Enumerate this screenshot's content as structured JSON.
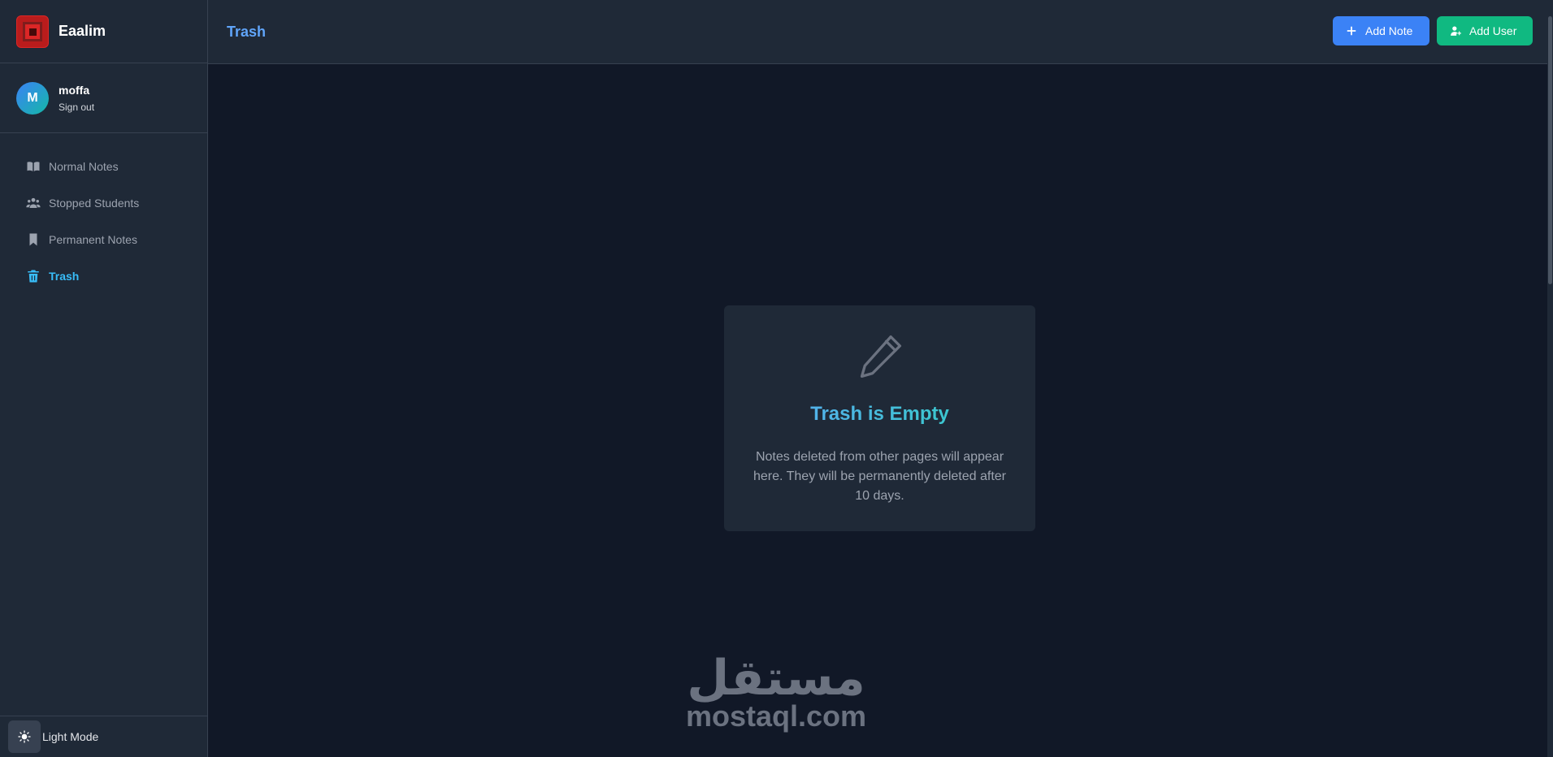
{
  "brand": {
    "name": "Eaalim"
  },
  "user": {
    "initial": "M",
    "name": "moffa",
    "sign_out": "Sign out"
  },
  "sidebar": {
    "items": [
      {
        "label": "Normal Notes",
        "icon": "book-open-icon",
        "active": false
      },
      {
        "label": "Stopped Students",
        "icon": "users-icon",
        "active": false
      },
      {
        "label": "Permanent Notes",
        "icon": "bookmark-icon",
        "active": false
      },
      {
        "label": "Trash",
        "icon": "trash-icon",
        "active": true
      }
    ],
    "theme_label": "Light Mode"
  },
  "header": {
    "title": "Trash",
    "add_note_label": "Add Note",
    "add_user_label": "Add User"
  },
  "empty_state": {
    "icon": "pencil-icon",
    "title": "Trash is Empty",
    "description": "Notes deleted from other pages will appear here. They will be permanently deleted after 10 days."
  },
  "watermark": {
    "arabic": "مستقل",
    "latin": "mostaql.com"
  },
  "colors": {
    "accent_blue": "#3b82f6",
    "accent_green": "#10b981",
    "active_nav": "#38bdf8",
    "background": "#111827",
    "panel": "#1f2937"
  }
}
